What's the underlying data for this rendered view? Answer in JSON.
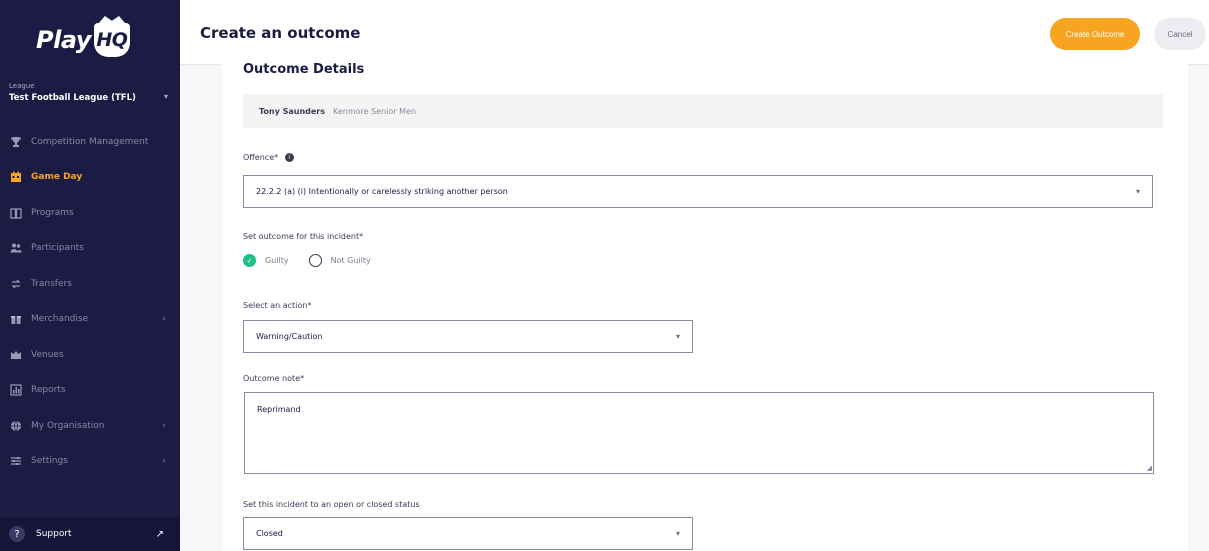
{
  "app": {
    "logo_text": "Play",
    "logo_badge": "HQ"
  },
  "org": {
    "caption": "League",
    "name": "Test Football League (TFL)"
  },
  "sidebar": {
    "items": [
      {
        "label": "Competition Management",
        "icon": "trophy-icon",
        "active": false,
        "chevron": false
      },
      {
        "label": "Game Day",
        "icon": "calendar-icon",
        "active": true,
        "chevron": false
      },
      {
        "label": "Programs",
        "icon": "book-icon",
        "active": false,
        "chevron": false
      },
      {
        "label": "Participants",
        "icon": "people-icon",
        "active": false,
        "chevron": false
      },
      {
        "label": "Transfers",
        "icon": "transfer-icon",
        "active": false,
        "chevron": false
      },
      {
        "label": "Merchandise",
        "icon": "gift-icon",
        "active": false,
        "chevron": true
      },
      {
        "label": "Venues",
        "icon": "venue-icon",
        "active": false,
        "chevron": false
      },
      {
        "label": "Reports",
        "icon": "chart-icon",
        "active": false,
        "chevron": false
      },
      {
        "label": "My Organisation",
        "icon": "globe-icon",
        "active": false,
        "chevron": true
      },
      {
        "label": "Settings",
        "icon": "sliders-icon",
        "active": false,
        "chevron": true
      }
    ],
    "support_label": "Support"
  },
  "header": {
    "title": "Create an outcome",
    "primary_label": "Create Outcome",
    "cancel_label": "Cancel"
  },
  "form": {
    "section_title": "Outcome Details",
    "participant_name": "Tony Saunders",
    "participant_team": "Kenmore Senior Men",
    "offence_label": "Offence*",
    "offence_value": "22.2.2 (a) (i) Intentionally or carelessly striking another person",
    "outcome_label": "Set outcome for this incident*",
    "outcome_options": [
      "Guilty",
      "Not Guilty"
    ],
    "outcome_selected": "Guilty",
    "action_label": "Select an action*",
    "action_value": "Warning/Caution",
    "note_label": "Outcome note*",
    "note_value": "Reprimand",
    "status_label": "Set this incident to an open or closed status",
    "status_value": "Closed"
  },
  "colors": {
    "sidebar_bg": "#1b1b44",
    "accent": "#f7a521",
    "success": "#1fbf86"
  }
}
